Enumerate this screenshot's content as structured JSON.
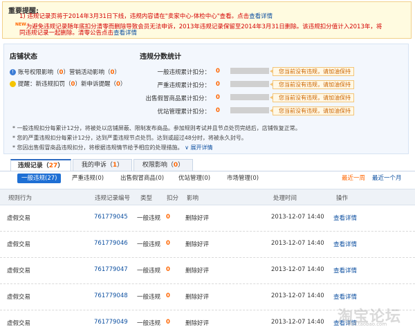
{
  "notice": {
    "title": "重要提醒:",
    "line1_text": "1) 违规记录页将于2014年3月31日下线，违规内容请在\"卖家中心-体检中心\"查看。点击",
    "line1_link": "查看详情",
    "line2_badge": "NEW",
    "line2_text": "为避免违规记录随年底扣分清零而删除导致会员无法申诉，2013年违规记录保留至2014年3月31日删除。该违规扣分值计入2013年，将",
    "line3_text": "同违规记录一起删除。清零公告点击",
    "line3_link": "查看详情"
  },
  "shop_status": {
    "title": "店铺状态",
    "row1_a": "账号权限影响（",
    "row1_a_num": "0",
    "row1_b": "）营销活动影响（",
    "row1_b_num": "0",
    "row1_c": "）",
    "row2_a": "提醒：新违规扣罚（",
    "row2_a_num": "0",
    "row2_b": "）新申诉提醒（",
    "row2_b_num": "0",
    "row2_c": "）"
  },
  "score_stats": {
    "title": "违规分数统计",
    "items": [
      {
        "label": "一般违规累计扣分：",
        "score": "0",
        "tip": "您当前没有违规，请加油保持"
      },
      {
        "label": "严重违规累计扣分：",
        "score": "0",
        "tip": "您当前没有违规，请加油保持"
      },
      {
        "label": "出售假冒商品累计扣分：",
        "score": "0",
        "tip": "您当前没有违规，请加油保持"
      },
      {
        "label": "优站管理累计扣分：",
        "score": "0",
        "tip": "您当前没有违规，请加油保持"
      }
    ]
  },
  "notes": {
    "n1": "* 一般违规扣分每累计12分，将被处以店铺屏蔽、限制发布商品。参加规则考试并且节点处罚完结后，店铺恢复正常。",
    "n2": "* 您的严重违规扣分每累计12分，达到严重违规节点处罚。达到或超过48分时，将被永久封号。",
    "n3": "* 您因出售假冒商品违规扣分，将根据违规情节给予相应的处理措施。",
    "expand": "展开详情"
  },
  "tabs": [
    {
      "label": "违规记录（",
      "count": "27",
      "tail": "）"
    },
    {
      "label": "我的申诉（",
      "count": "1",
      "tail": "）"
    },
    {
      "label": "权限影响（",
      "count": "0",
      "tail": "）"
    }
  ],
  "subtabs": [
    "一般违规(27)",
    "严重违规(0)",
    "出售假冒商品(0)",
    "优站管理(0)",
    "市场管理(0)"
  ],
  "periods": {
    "week": "最近一周",
    "month": "最近一个月"
  },
  "table": {
    "headers": [
      "规则行为",
      "违规记录编号",
      "类型",
      "扣分",
      "影响",
      "处理时间",
      "操作"
    ],
    "rows": [
      {
        "rule": "虚假交易",
        "id": "761779045",
        "type": "一般违规",
        "points": "0",
        "effect": "删除好评",
        "time": "2013-12-07 14:40",
        "action": "查看详情"
      },
      {
        "rule": "虚假交易",
        "id": "761779046",
        "type": "一般违规",
        "points": "0",
        "effect": "删除好评",
        "time": "2013-12-07 14:40",
        "action": "查看详情"
      },
      {
        "rule": "虚假交易",
        "id": "761779047",
        "type": "一般违规",
        "points": "0",
        "effect": "删除好评",
        "time": "2013-12-07 14:40",
        "action": "查看详情"
      },
      {
        "rule": "虚假交易",
        "id": "761779048",
        "type": "一般违规",
        "points": "0",
        "effect": "删除好评",
        "time": "2013-12-07 14:40",
        "action": "查看详情"
      },
      {
        "rule": "虚假交易",
        "id": "761779049",
        "type": "一般违规",
        "points": "0",
        "effect": "删除好评",
        "time": "2013-12-07 14:40",
        "action": "查看详情"
      }
    ]
  },
  "watermark": {
    "main": "淘宝论坛",
    "sub": "bbs.taobao.com"
  }
}
